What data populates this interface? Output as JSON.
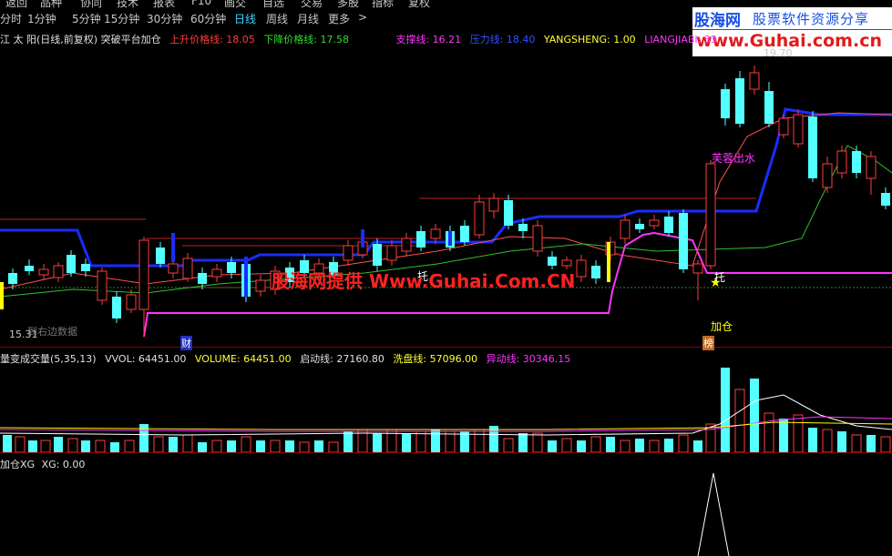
{
  "top_menu": [
    "返回",
    "品种",
    "协同",
    "技术",
    "报表",
    "F10",
    "画交",
    "自选",
    "交易",
    "多股",
    "指标",
    "复权"
  ],
  "periods": [
    "分时",
    "1分钟",
    "5分钟",
    "15分钟",
    "30分钟",
    "60分钟",
    "日线",
    "周线",
    "月线",
    "更多"
  ],
  "active_period": "日线",
  "more_arrow": ">",
  "logo": {
    "brand": "股海网",
    "slogan": "股票软件资源分享",
    "url": "www.Guhai.com.cn"
  },
  "main_legend": {
    "title": "江 太 阳(日线,前复权) 突破平台加仓",
    "up_price": "上升价格线: 18.05",
    "down_price": "下降价格线: 17.58",
    "support": "支撑线: 16.21",
    "pressure": "压力线: 18.40",
    "yangsheng": "YANGSHENG: 1.00",
    "liangjiabi": "LIANGJIABI: 33"
  },
  "price_labels": {
    "high": "19.70",
    "low": "15.31",
    "hint": "到右边数据",
    "signal_furong": "芙蓉出水",
    "signal_tuo1": "托",
    "signal_tuo2": "托",
    "signal_jiacang": "加仓",
    "signal_bang": "榜",
    "signal_cai": "财",
    "watermark": "股海网提供 Www.Guhai.Com.CN"
  },
  "volume_legend": {
    "title": "量变成交量(5,35,13)",
    "vvol": "VVOL: 64451.00",
    "volume": "VOLUME: 64451.00",
    "qidong": "启动线: 27160.80",
    "xipan": "洗盘线: 57096.00",
    "yidong": "异动线: 30346.15"
  },
  "xg_legend": {
    "title": "加仓XG",
    "value": "XG: 0.00"
  },
  "colors": {
    "up": "#ff3c3c",
    "down": "#54ffff",
    "blue": "#1a2cff",
    "magenta": "#ff33ff",
    "green": "#2fbf2f",
    "yellow": "#ffff00"
  }
}
